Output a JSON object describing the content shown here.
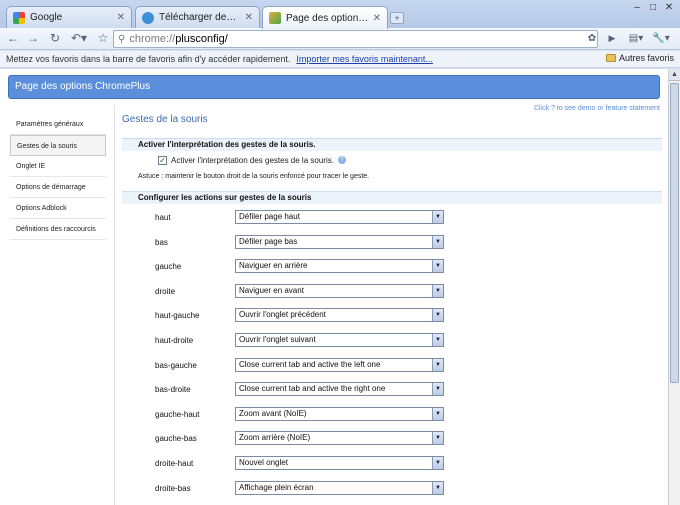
{
  "tabs": [
    {
      "title": "Google",
      "favicon_color": "#3b7ddd"
    },
    {
      "title": "Télécharger des logiciels et...",
      "favicon_color": "#3f8fd6"
    },
    {
      "title": "Page des options ChromePlus",
      "favicon_color": "#4ca34a"
    }
  ],
  "toolbar": {
    "url_scheme": "chrome://",
    "url_path": "plusconfig/"
  },
  "bookmarks": {
    "message": "Mettez vos favoris dans la barre de favoris afin d'y accéder rapidement.",
    "import_link": "Importer mes favoris maintenant...",
    "other": "Autres favoris"
  },
  "page": {
    "banner": "Page des options ChromePlus",
    "feature_link": "Click ? to see demo or feature statement",
    "nav": [
      {
        "label": "Paramètres généraux",
        "selected": false
      },
      {
        "label": "Gestes de la souris",
        "selected": true
      },
      {
        "label": "Onglet IE",
        "selected": false
      },
      {
        "label": "Options de démarrage",
        "selected": false
      },
      {
        "label": "Options Adblock",
        "selected": false
      },
      {
        "label": "Définitions des raccourcis",
        "selected": false
      }
    ],
    "section_title": "Gestes de la souris",
    "group1": {
      "header": "Activer l'interprétation des gestes de la souris.",
      "checkbox_label": "Activer l'interprétation des gestes de la souris.",
      "checked": true,
      "hint": "Astuce : maintenir le bouton droit de la souris enfoncé pour tracer le geste."
    },
    "group2": {
      "header": "Configurer les actions sur gestes de la souris",
      "actions": [
        {
          "label": "haut",
          "value": "Défiler page haut"
        },
        {
          "label": "bas",
          "value": "Défiler page bas"
        },
        {
          "label": "gauche",
          "value": "Naviguer en arrière"
        },
        {
          "label": "droite",
          "value": "Naviguer en avant"
        },
        {
          "label": "haut-gauche",
          "value": "Ouvrir l'onglet précédent"
        },
        {
          "label": "haut-droite",
          "value": "Ouvrir l'onglet suivant"
        },
        {
          "label": "bas-gauche",
          "value": "Close current tab and active the left one"
        },
        {
          "label": "bas-droite",
          "value": "Close current tab and active the right one"
        },
        {
          "label": "gauche-haut",
          "value": "Zoom avant (NoIE)"
        },
        {
          "label": "gauche-bas",
          "value": "Zoom arrière (NoIE)"
        },
        {
          "label": "droite-haut",
          "value": "Nouvel onglet"
        },
        {
          "label": "droite-bas",
          "value": "Affichage plein écran"
        }
      ]
    }
  }
}
